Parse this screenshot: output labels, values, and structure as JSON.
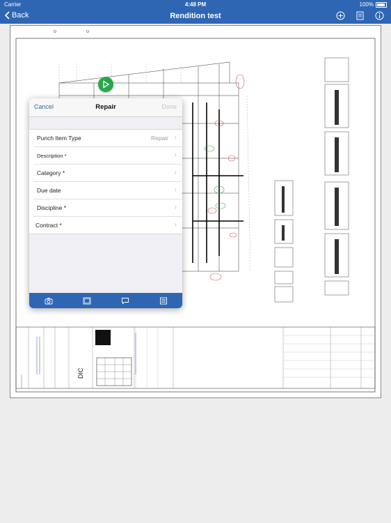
{
  "status_bar": {
    "carrier": "Carrier",
    "time": "4:48 PM",
    "battery": "100%"
  },
  "nav": {
    "back_label": "Back",
    "title": "Rendition test",
    "icons": [
      "plus-circle-icon",
      "document-icon",
      "info-icon"
    ]
  },
  "form": {
    "cancel_label": "Cancel",
    "title": "Repair",
    "done_label": "Done",
    "rows": [
      {
        "label": "Punch Item Type",
        "value": "Repair"
      },
      {
        "label": "Description *",
        "value": ""
      },
      {
        "label": "Category *",
        "value": ""
      },
      {
        "label": "Due date",
        "value": ""
      },
      {
        "label": "Discipline *",
        "value": ""
      },
      {
        "label": "Contract *",
        "value": ""
      }
    ],
    "toolbar_icons": [
      "camera-icon",
      "image-icon",
      "comment-icon",
      "list-icon"
    ]
  },
  "drawing": {
    "title_block_text": "DIC"
  },
  "colors": {
    "nav_blue": "#2f66b3",
    "play_green": "#27a84a"
  }
}
